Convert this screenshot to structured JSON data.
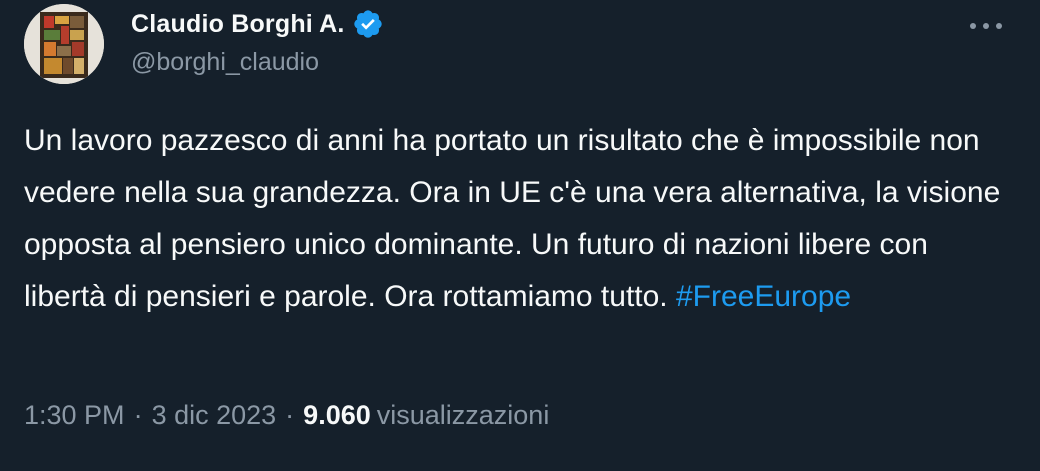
{
  "author": {
    "display_name": "Claudio Borghi A.",
    "handle": "@borghi_claudio",
    "verified": true,
    "verified_color": "#1d9bf0"
  },
  "tweet": {
    "text": "Un lavoro pazzesco di anni ha portato un risultato che è impossibile non vedere nella sua grandezza. Ora in UE c'è una vera alternativa, la visione opposta al pensiero unico dominante. Un futuro di nazioni libere con libertà di pensieri e parole. Ora rottamiamo tutto. ",
    "hashtag": "#FreeEurope"
  },
  "meta": {
    "time": "1:30 PM",
    "separator": "·",
    "date": "3 dic 2023",
    "views_count": "9.060",
    "views_label": "visualizzazioni"
  },
  "icons": {
    "more": "more-horizontal-icon",
    "verified": "verified-badge-icon"
  },
  "colors": {
    "background": "#15202b",
    "text": "#f7f9f9",
    "secondary": "#8b98a5",
    "accent": "#1d9bf0"
  }
}
